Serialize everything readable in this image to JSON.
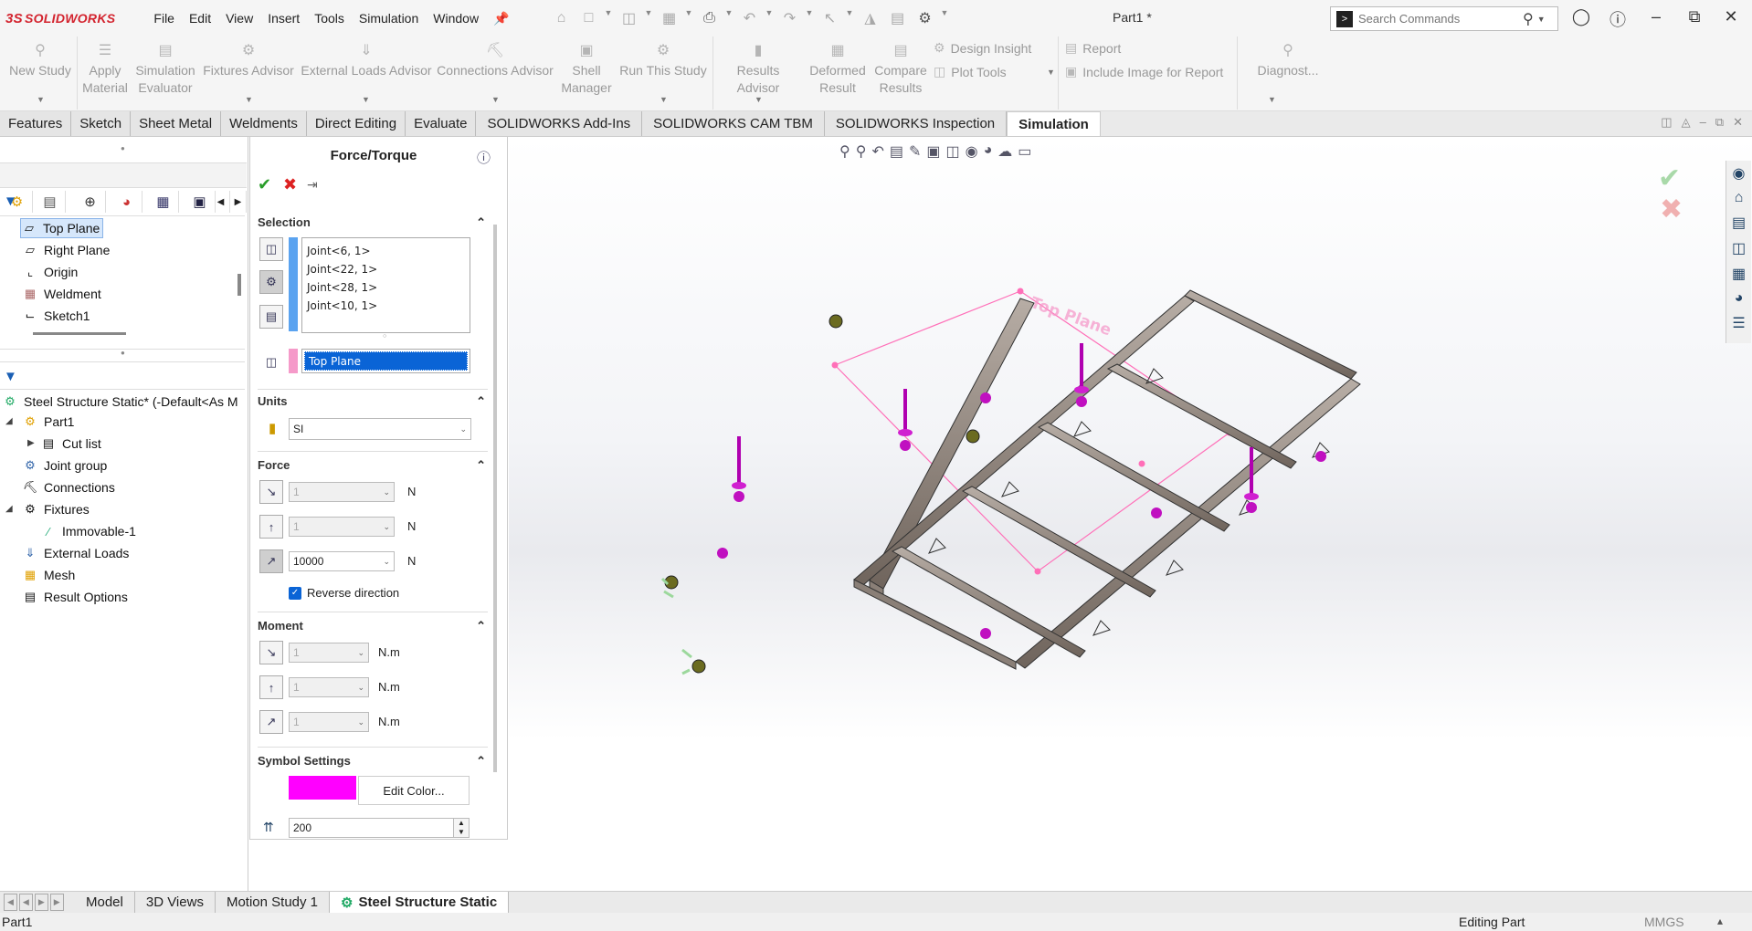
{
  "app": {
    "name": "SOLIDWORKS",
    "doc_title": "Part1 *"
  },
  "menu": [
    "File",
    "Edit",
    "View",
    "Insert",
    "Tools",
    "Simulation",
    "Window"
  ],
  "search": {
    "placeholder": "Search Commands"
  },
  "ribbon": {
    "new_study": "New Study",
    "apply_material": [
      "Apply",
      "Material"
    ],
    "sim_evaluator": [
      "Simulation",
      "Evaluator"
    ],
    "fixtures_advisor": "Fixtures Advisor",
    "ext_loads_advisor": "External Loads Advisor",
    "connections_advisor": "Connections Advisor",
    "shell_manager": [
      "Shell",
      "Manager"
    ],
    "run_this_study": "Run This Study",
    "results_advisor": "Results Advisor",
    "deformed_result": [
      "Deformed",
      "Result"
    ],
    "compare_results": [
      "Compare",
      "Results"
    ],
    "design_insight": "Design Insight",
    "plot_tools": "Plot Tools",
    "report": "Report",
    "include_image": "Include Image for Report",
    "diagnostics": "Diagnost..."
  },
  "cmd_tabs": [
    "Features",
    "Sketch",
    "Sheet Metal",
    "Weldments",
    "Direct Editing",
    "Evaluate",
    "SOLIDWORKS Add-Ins",
    "SOLIDWORKS CAM TBM",
    "SOLIDWORKS Inspection",
    "Simulation"
  ],
  "feature_tree": {
    "items": [
      "Top Plane",
      "Right Plane",
      "Origin",
      "Weldment",
      "Sketch1"
    ]
  },
  "sim_tree": {
    "study": "Steel Structure Static* (-Default<As M",
    "items": [
      "Part1",
      "Cut list",
      "Joint group",
      "Connections",
      "Fixtures",
      "Immovable-1",
      "External Loads",
      "Mesh",
      "Result Options"
    ]
  },
  "pm": {
    "title": "Force/Torque",
    "selection_label": "Selection",
    "joints": [
      "Joint<6, 1>",
      "Joint<22, 1>",
      "Joint<28, 1>",
      "Joint<10, 1>"
    ],
    "direction_ref": "Top Plane",
    "units_label": "Units",
    "units_value": "SI",
    "force_label": "Force",
    "force_x": "1",
    "force_y": "1",
    "force_z": "10000",
    "force_unit": "N",
    "reverse": "Reverse direction",
    "moment_label": "Moment",
    "moment_x": "1",
    "moment_y": "1",
    "moment_z": "1",
    "moment_unit": "N.m",
    "symbol_label": "Symbol Settings",
    "edit_color": "Edit Color...",
    "symbol_color": "#ff00ff",
    "symbol_size": "200"
  },
  "viewport": {
    "plane_label": "Top Plane"
  },
  "bottom_tabs": [
    "Model",
    "3D Views",
    "Motion Study 1",
    "Steel Structure Static"
  ],
  "status": {
    "left": "Part1",
    "editing": "Editing Part",
    "units": "MMGS"
  }
}
